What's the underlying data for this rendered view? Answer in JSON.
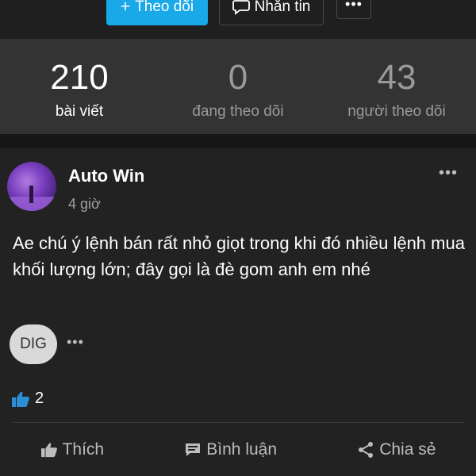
{
  "header": {
    "follow_label": "Theo dõi",
    "message_label": "Nhắn tin",
    "more_label": "•••"
  },
  "stats": [
    {
      "value": "210",
      "label": "bài viết"
    },
    {
      "value": "0",
      "label": "đang theo dõi"
    },
    {
      "value": "43",
      "label": "người theo dõi"
    }
  ],
  "post": {
    "author": "Auto Win",
    "time": "4 giờ",
    "more_label": "•••",
    "content": "Ae chú ý lệnh bán rất nhỏ giọt trong khi đó nhiều lệnh mua khối lượng lớn; đây gọi là đè gom anh em nhé",
    "tag": "DIG",
    "tag_more": "•••",
    "like_count": "2",
    "actions": {
      "like": "Thích",
      "comment": "Bình luận",
      "share": "Chia sẻ"
    }
  },
  "colors": {
    "accent": "#19a8e8",
    "background": "#1f1f1f",
    "stats_bg": "#333333",
    "like_icon": "#2a8fd6"
  },
  "icons": {
    "plus": "plus-icon",
    "message": "speech-bubble-icon",
    "like": "thumbs-up-icon",
    "comment": "comment-icon",
    "share": "share-icon"
  }
}
